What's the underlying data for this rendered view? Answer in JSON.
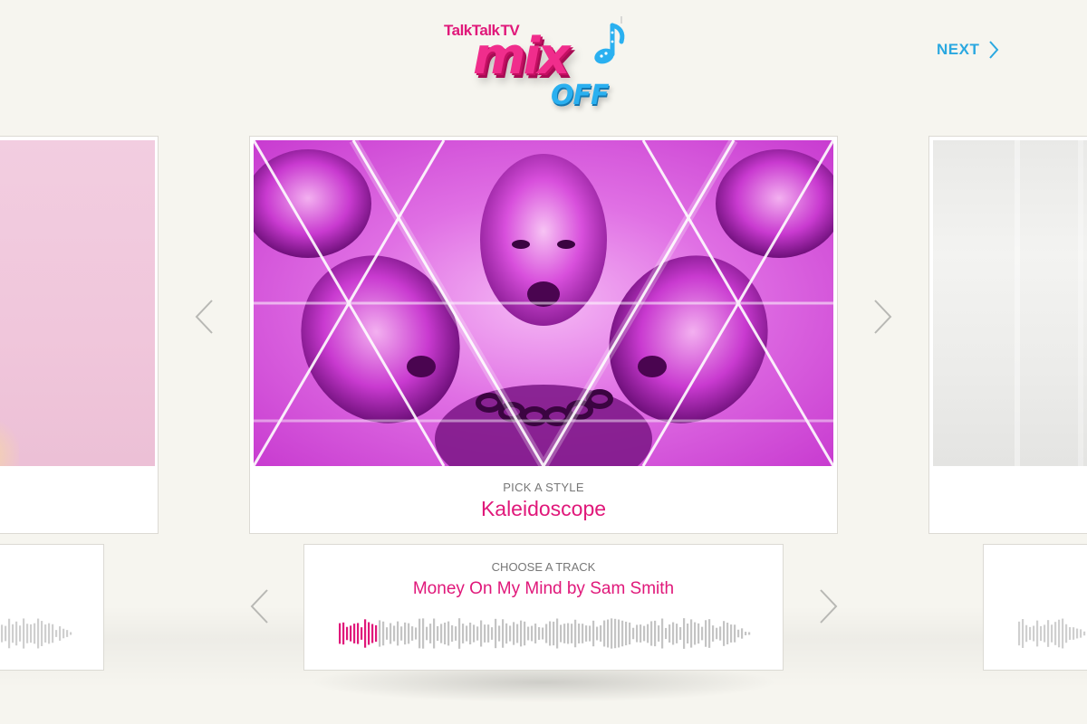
{
  "header": {
    "brand_text": "TalkTalk",
    "brand_tv": "TV",
    "logo_mix": "mix",
    "logo_off": "OFF",
    "next_label": "NEXT"
  },
  "style_picker": {
    "label": "PICK A STYLE",
    "selected_style": "Kaleidoscope"
  },
  "track_picker": {
    "label": "CHOOSE A TRACK",
    "selected_track": "Money On My Mind by Sam Smith",
    "progress": 0.1
  },
  "colors": {
    "accent_pink": "#e0187a",
    "accent_blue": "#2aa8e0",
    "background": "#f6f5ef"
  },
  "icons": [
    "music-note-icon",
    "chevron-right-icon",
    "chevron-left-icon"
  ]
}
